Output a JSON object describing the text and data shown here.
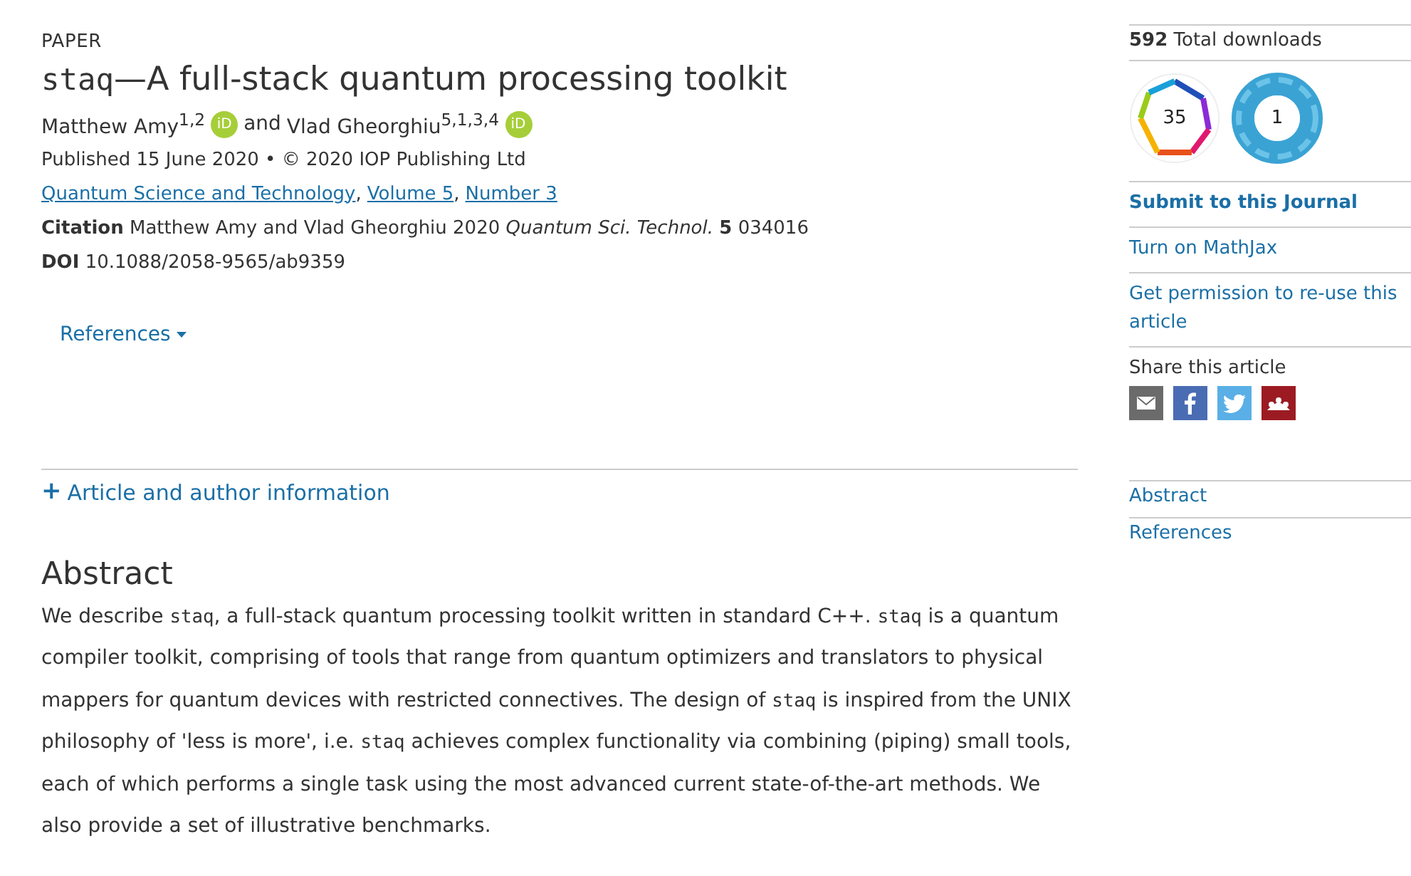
{
  "article_type": "PAPER",
  "title": [
    {
      "kind": "code",
      "text": "staq"
    },
    {
      "kind": "text",
      "text": "—A full-stack quantum processing toolkit"
    }
  ],
  "authors": [
    {
      "name": "Matthew Amy",
      "affiliations": "1,2",
      "orcid": "iD"
    },
    {
      "joiner": "and",
      "name": "Vlad Gheorghiu",
      "affiliations": "5,1,3,4",
      "orcid": "iD"
    }
  ],
  "published": "Published 15 June 2020 • © 2020 IOP Publishing Ltd",
  "journal_links": [
    "Quantum Science and Technology",
    "Volume 5",
    "Number 3"
  ],
  "link_separator": ",",
  "citation": {
    "label": "Citation",
    "text": "Matthew Amy and Vlad Gheorghiu 2020 *Quantum Sci. Technol.* **5** 034016"
  },
  "doi": {
    "label": "DOI",
    "value": "10.1088/2058-9565/ab9359"
  },
  "references_dropdown": "References",
  "article_info_toggle": {
    "icon": "+",
    "label": "Article and author information"
  },
  "abstract": {
    "heading": "Abstract",
    "segments": [
      {
        "kind": "text",
        "text": "We describe "
      },
      {
        "kind": "code",
        "text": "staq"
      },
      {
        "kind": "text",
        "text": ", a full-stack quantum processing toolkit written in standard C++. "
      },
      {
        "kind": "code",
        "text": "staq"
      },
      {
        "kind": "text",
        "text": " is a quantum compiler toolkit, comprising of tools that range from quantum optimizers and translators to physical mappers for quantum devices with restricted connectives. The design of "
      },
      {
        "kind": "code",
        "text": "staq"
      },
      {
        "kind": "text",
        "text": " is inspired from the UNIX philosophy of 'less is more', i.e. "
      },
      {
        "kind": "code",
        "text": "staq"
      },
      {
        "kind": "text",
        "text": " achieves complex functionality via combining (piping) small tools, each of which performs a single task using the most advanced current state-of-the-art methods. We also provide a set of illustrative benchmarks."
      }
    ]
  },
  "sidebar": {
    "downloads": {
      "count": "592",
      "label": "Total downloads"
    },
    "badges": [
      {
        "kind": "dimensions",
        "value": "35"
      },
      {
        "kind": "altmetric",
        "value": "1"
      }
    ],
    "links": [
      {
        "label": "Submit to this Journal",
        "bold": true
      },
      {
        "label": "Turn on MathJax",
        "bold": false
      },
      {
        "label": "Get permission to re-use this article",
        "bold": false
      }
    ],
    "share": {
      "label": "Share this article",
      "buttons": [
        {
          "kind": "email",
          "color": "#6b6b6b"
        },
        {
          "kind": "facebook",
          "color": "#4a6cb3"
        },
        {
          "kind": "twitter",
          "color": "#5aafe6"
        },
        {
          "kind": "mendeley",
          "color": "#9c1b22"
        }
      ]
    },
    "nav": [
      "Abstract",
      "References"
    ]
  }
}
